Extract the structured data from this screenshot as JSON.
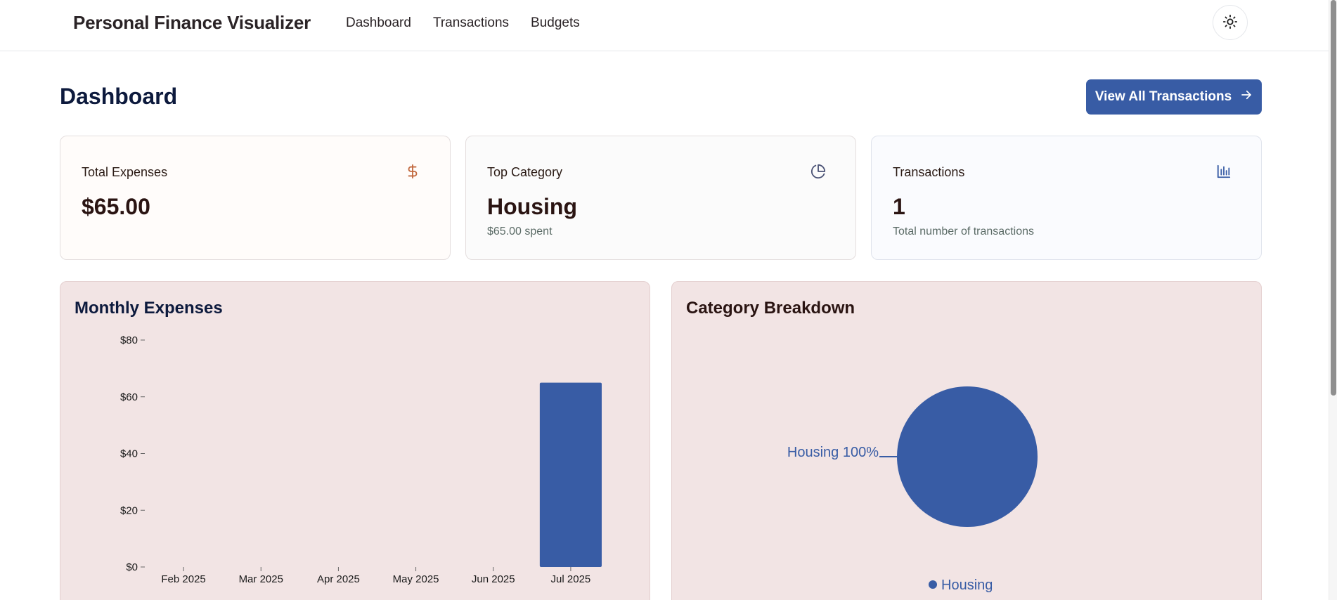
{
  "header": {
    "brand": "Personal Finance Visualizer",
    "nav": [
      {
        "label": "Dashboard"
      },
      {
        "label": "Transactions"
      },
      {
        "label": "Budgets"
      }
    ],
    "theme_toggle_icon": "sun-icon"
  },
  "page": {
    "title": "Dashboard",
    "view_all_label": "View All Transactions",
    "view_all_icon": "arrow-right-icon"
  },
  "stats": [
    {
      "label": "Total Expenses",
      "value": "$65.00",
      "sub": "",
      "icon": "dollar-icon",
      "icon_color": "#c2693f"
    },
    {
      "label": "Top Category",
      "value": "Housing",
      "sub": "$65.00 spent",
      "icon": "pie-chart-icon",
      "icon_color": "#4a5275"
    },
    {
      "label": "Transactions",
      "value": "1",
      "sub": "Total number of transactions",
      "icon": "bar-chart-icon",
      "icon_color": "#385ca5"
    }
  ],
  "panels": {
    "monthly_title": "Monthly Expenses",
    "category_title": "Category Breakdown"
  },
  "colors": {
    "accent": "#385ca5",
    "panel_bg": "#f2e4e4"
  },
  "chart_data": [
    {
      "type": "bar",
      "title": "Monthly Expenses",
      "categories": [
        "Feb 2025",
        "Mar 2025",
        "Apr 2025",
        "May 2025",
        "Jun 2025",
        "Jul 2025"
      ],
      "values": [
        0,
        0,
        0,
        0,
        0,
        65
      ],
      "yticks": [
        "$0",
        "$20",
        "$40",
        "$60",
        "$80"
      ],
      "ylim": [
        0,
        80
      ],
      "grid": false,
      "color": "#385ca5"
    },
    {
      "type": "pie",
      "title": "Category Breakdown",
      "slices": [
        {
          "label": "Housing",
          "value": 100,
          "display": "Housing 100%"
        }
      ],
      "legend": [
        "Housing"
      ],
      "legend_position": "bottom",
      "color": "#385ca5"
    }
  ]
}
